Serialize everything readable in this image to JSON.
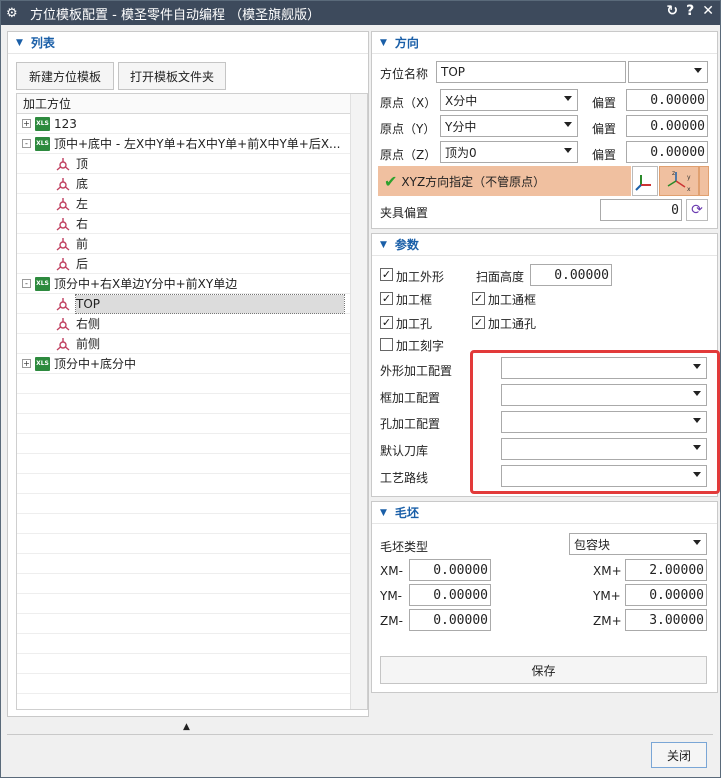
{
  "window": {
    "title": "方位模板配置 - 模圣零件自动编程  （模圣旗舰版）",
    "title_icon": "gear-icon",
    "controls": [
      "refresh-icon",
      "help-icon",
      "close-icon"
    ]
  },
  "list": {
    "header": "列表",
    "buttons": {
      "new_template": "新建方位模板",
      "open_folder": "打开模板文件夹"
    },
    "tree_header": "加工方位",
    "items": [
      {
        "label": "123",
        "type": "xls",
        "toggle": "+"
      },
      {
        "label": "顶中+底中 - 左X中Y单+右X中Y单+前X中Y单+后X...",
        "type": "xls",
        "toggle": "-"
      },
      {
        "label": "顶",
        "type": "axis"
      },
      {
        "label": "底",
        "type": "axis"
      },
      {
        "label": "左",
        "type": "axis"
      },
      {
        "label": "右",
        "type": "axis"
      },
      {
        "label": "前",
        "type": "axis"
      },
      {
        "label": "后",
        "type": "axis"
      },
      {
        "label": "顶分中+右X单边Y分中+前XY单边",
        "type": "xls",
        "toggle": "-"
      },
      {
        "label": "TOP",
        "type": "axis",
        "selected": true
      },
      {
        "label": "右侧",
        "type": "axis"
      },
      {
        "label": "前侧",
        "type": "axis"
      },
      {
        "label": "顶分中+底分中",
        "type": "xls",
        "toggle": "+"
      }
    ]
  },
  "direction": {
    "header": "方向",
    "name_label": "方位名称",
    "name_value": "TOP",
    "origin_x_label": "原点（X）",
    "origin_x_value": "X分中",
    "origin_y_label": "原点（Y）",
    "origin_y_value": "Y分中",
    "origin_z_label": "原点（Z）",
    "origin_z_value": "顶为0",
    "offset_label": "偏置",
    "offset_x": "0.00000",
    "offset_y": "0.00000",
    "offset_z": "0.00000",
    "xyz_label": "XYZ方向指定（不管原点）",
    "fixture_label": "夹具偏置",
    "fixture_value": "0"
  },
  "params": {
    "header": "参数",
    "outer": "加工外形",
    "scan_height_label": "扫面高度",
    "scan_height_value": "0.00000",
    "frame": "加工框",
    "through_frame": "加工通框",
    "hole": "加工孔",
    "through_hole": "加工通孔",
    "engrave": "加工刻字",
    "outer_config": "外形加工配置",
    "frame_config": "框加工配置",
    "hole_config": "孔加工配置",
    "tool_lib": "默认刀库",
    "route": "工艺路线"
  },
  "blank": {
    "header": "毛坯",
    "type_label": "毛坯类型",
    "type_value": "包容块",
    "xm_minus_label": "XM-",
    "xm_minus": "0.00000",
    "xm_plus_label": "XM+",
    "xm_plus": "2.00000",
    "ym_minus_label": "YM-",
    "ym_minus": "0.00000",
    "ym_plus_label": "YM+",
    "ym_plus": "0.00000",
    "zm_minus_label": "ZM-",
    "zm_minus": "0.00000",
    "zm_plus_label": "ZM+",
    "zm_plus": "3.00000",
    "save": "保存"
  },
  "footer": {
    "close": "关闭"
  },
  "colors": {
    "titlebar": "#3d4a5c",
    "accent": "#1a5fa8",
    "highlight": "#f0c0a0",
    "annotation": "#e23a3a"
  }
}
